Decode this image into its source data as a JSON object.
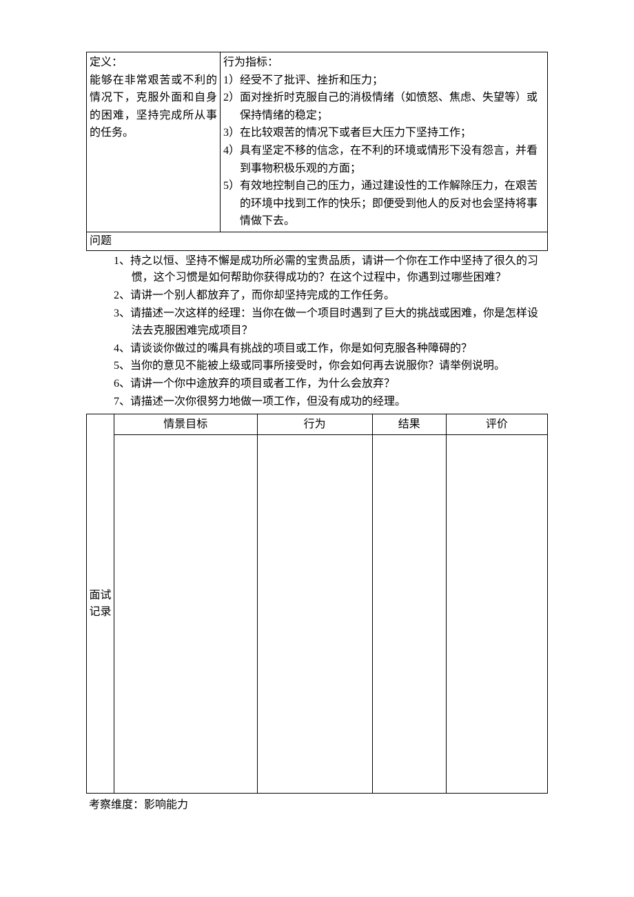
{
  "table1": {
    "def_label": "定义：",
    "def_body": "能够在非常艰苦或不利的情况下，克服外面和自身的困难，坚持完成所从事的任务。",
    "ind_label": "行为指标：",
    "indicators": [
      "经受不了批评、挫折和压力；",
      "面对挫折时克服自己的消极情绪（如愤怒、焦虑、失望等）或保持情绪的稳定；",
      "在比较艰苦的情况下或者巨大压力下坚持工作；",
      "具有坚定不移的信念，在不利的环境或情形下没有怨言，并看到事物积极乐观的方面；",
      "有效地控制自己的压力，通过建设性的工作解除压力，在艰苦的环境中找到工作的快乐；即便受到他人的反对也会坚持将事情做下去。"
    ],
    "question_label": "问题"
  },
  "questions": [
    "1、持之以恒、坚持不懈是成功所必需的宝贵品质，请讲一个你在工作中坚持了很久的习惯，这个习惯是如何帮助你获得成功的？在这个过程中，你遇到过哪些困难？",
    "2、请讲一个别人都放弃了，而你却坚持完成的工作任务。",
    "3、请描述一次这样的经理：当你在做一个项目时遇到了巨大的挑战或困难，你是怎样设法去克服困难完成项目？",
    "4、请谈谈你做过的嘴具有挑战的项目或工作，你是如何克服各种障碍的？",
    "5、当你的意见不能被上级或同事所接受时，你会如何再去说服你？请举例说明。",
    "6、请讲一个你中途放弃的项目或者工作，为什么会放弃？",
    "7、请描述一次你很努力地做一项工作，但没有成功的经理。"
  ],
  "record": {
    "label": "面试记录",
    "headers": {
      "scene": "情景目标",
      "behavior": "行为",
      "result": "结果",
      "eval": "评价"
    }
  },
  "dimension": "考察维度：影响能力"
}
